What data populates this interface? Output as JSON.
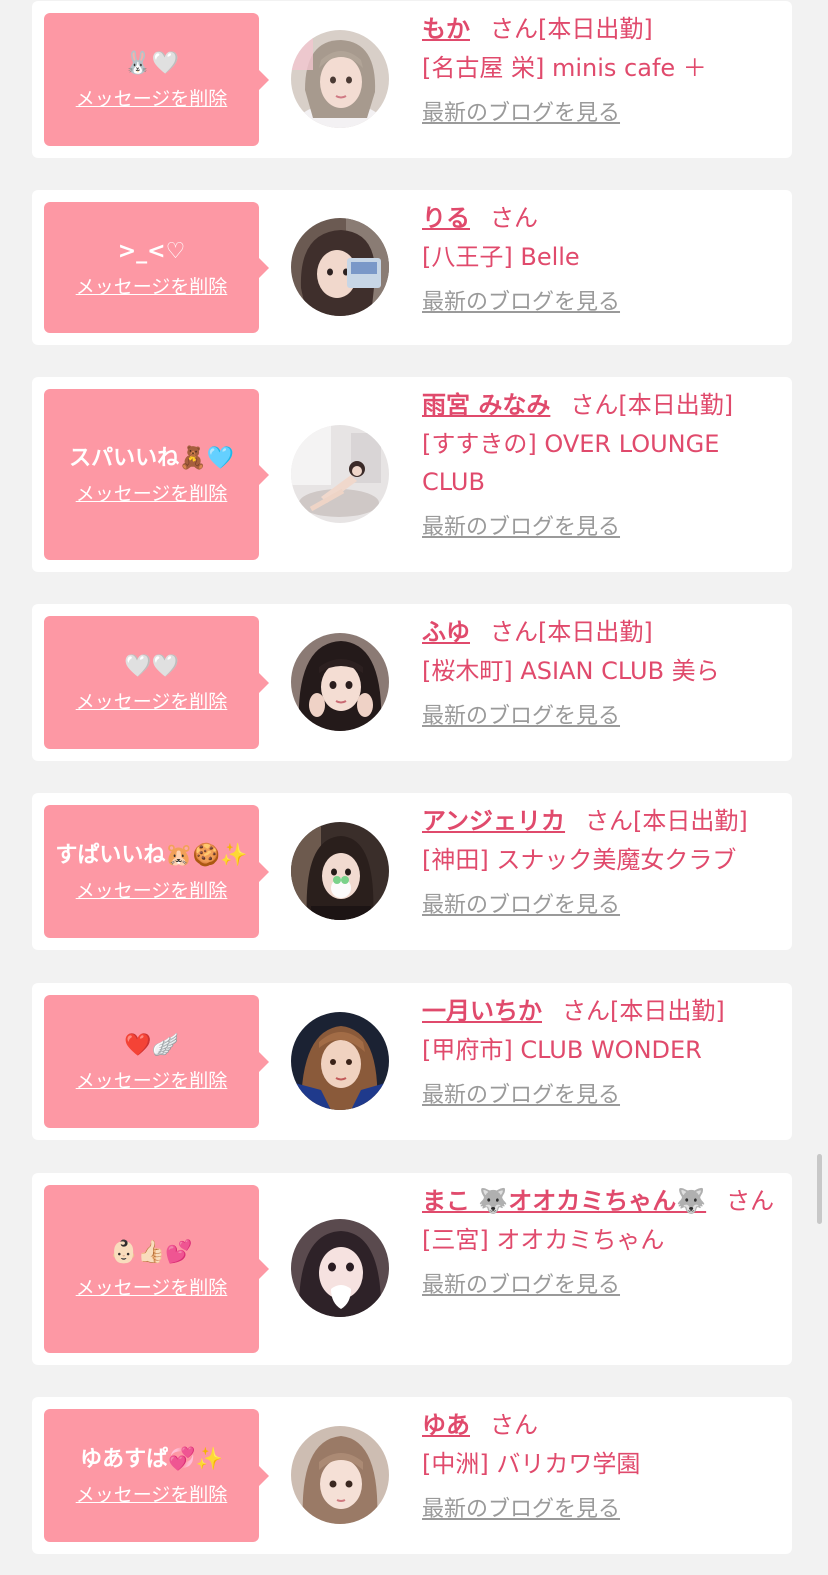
{
  "colors": {
    "page_bg": "#f2f2f2",
    "card_bg": "#ffffff",
    "bubble_bg": "#fd98a4",
    "accent": "#e04a6c",
    "link_gray": "#9a9a9a"
  },
  "delete_label": "メッセージを削除",
  "blog_label": "最新のブログを見る",
  "san_label": "さん",
  "items": [
    {
      "message": "🐰🤍",
      "name": "もか",
      "status": "[本日出勤]",
      "shop": "[名古屋 栄] minis cafe ＋",
      "avatar_icon": "girl-photo-1"
    },
    {
      "message": ">_<♡",
      "name": "りる",
      "status": "",
      "shop": "[八王子] Belle",
      "avatar_icon": "girl-photo-2"
    },
    {
      "message": "スパいいね🧸🩵",
      "name": "雨宮 みなみ",
      "status": "[本日出勤]",
      "shop": "[すすきの] OVER LOUNGE CLUB",
      "avatar_icon": "girl-photo-3"
    },
    {
      "message": "🤍🤍",
      "name": "ふゆ",
      "status": "[本日出勤]",
      "shop": "[桜木町] ASIAN CLUB 美ら",
      "avatar_icon": "girl-photo-4"
    },
    {
      "message": "すぱいいね🐹🍪✨",
      "name": "アンジェリカ",
      "status": "[本日出勤]",
      "shop": "[神田] スナック美魔女クラブ",
      "avatar_icon": "girl-photo-5"
    },
    {
      "message": "❤️🪽",
      "name": "一月いちか",
      "status": "[本日出勤]",
      "shop": "[甲府市] CLUB WONDER",
      "avatar_icon": "girl-photo-6"
    },
    {
      "message": "👶🏻👍🏻💕",
      "name": "まこ 🐺オオカミちゃん🐺",
      "status": "",
      "shop": "[三宮] オオカミちゃん",
      "avatar_icon": "girl-photo-7"
    },
    {
      "message": "ゆあすぱ💞✨",
      "name": "ゆあ",
      "status": "",
      "shop": "[中洲] バリカワ学園",
      "avatar_icon": "girl-photo-8"
    }
  ]
}
